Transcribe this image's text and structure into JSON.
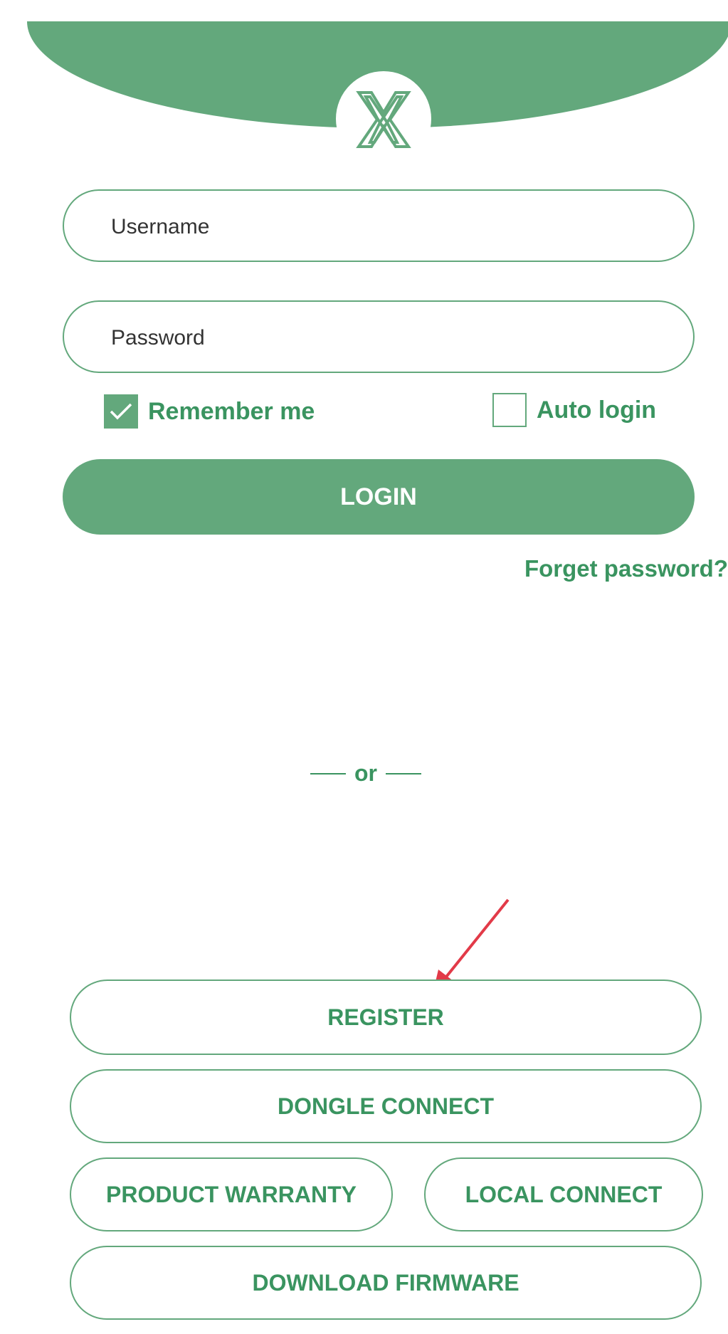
{
  "login_form": {
    "username_placeholder": "Username",
    "password_placeholder": "Password",
    "remember_me": {
      "label": "Remember me",
      "checked": true
    },
    "auto_login": {
      "label": "Auto login",
      "checked": false
    },
    "login_label": "LOGIN",
    "forget_password_label": "Forget password?"
  },
  "divider_text": "or",
  "actions": {
    "register_label": "REGISTER",
    "dongle_connect_label": "DONGLE CONNECT",
    "product_warranty_label": "PRODUCT WARRANTY",
    "local_connect_label": "LOCAL CONNECT",
    "download_firmware_label": "DOWNLOAD FIRMWARE"
  },
  "colors": {
    "brand_green": "#63a87c",
    "text_green": "#3a9460",
    "arrow_red": "#e23a48"
  },
  "icons": {
    "logo": "x-logo-icon",
    "checkmark": "checkmark-icon",
    "pointer_arrow": "arrow-annotation-icon"
  }
}
